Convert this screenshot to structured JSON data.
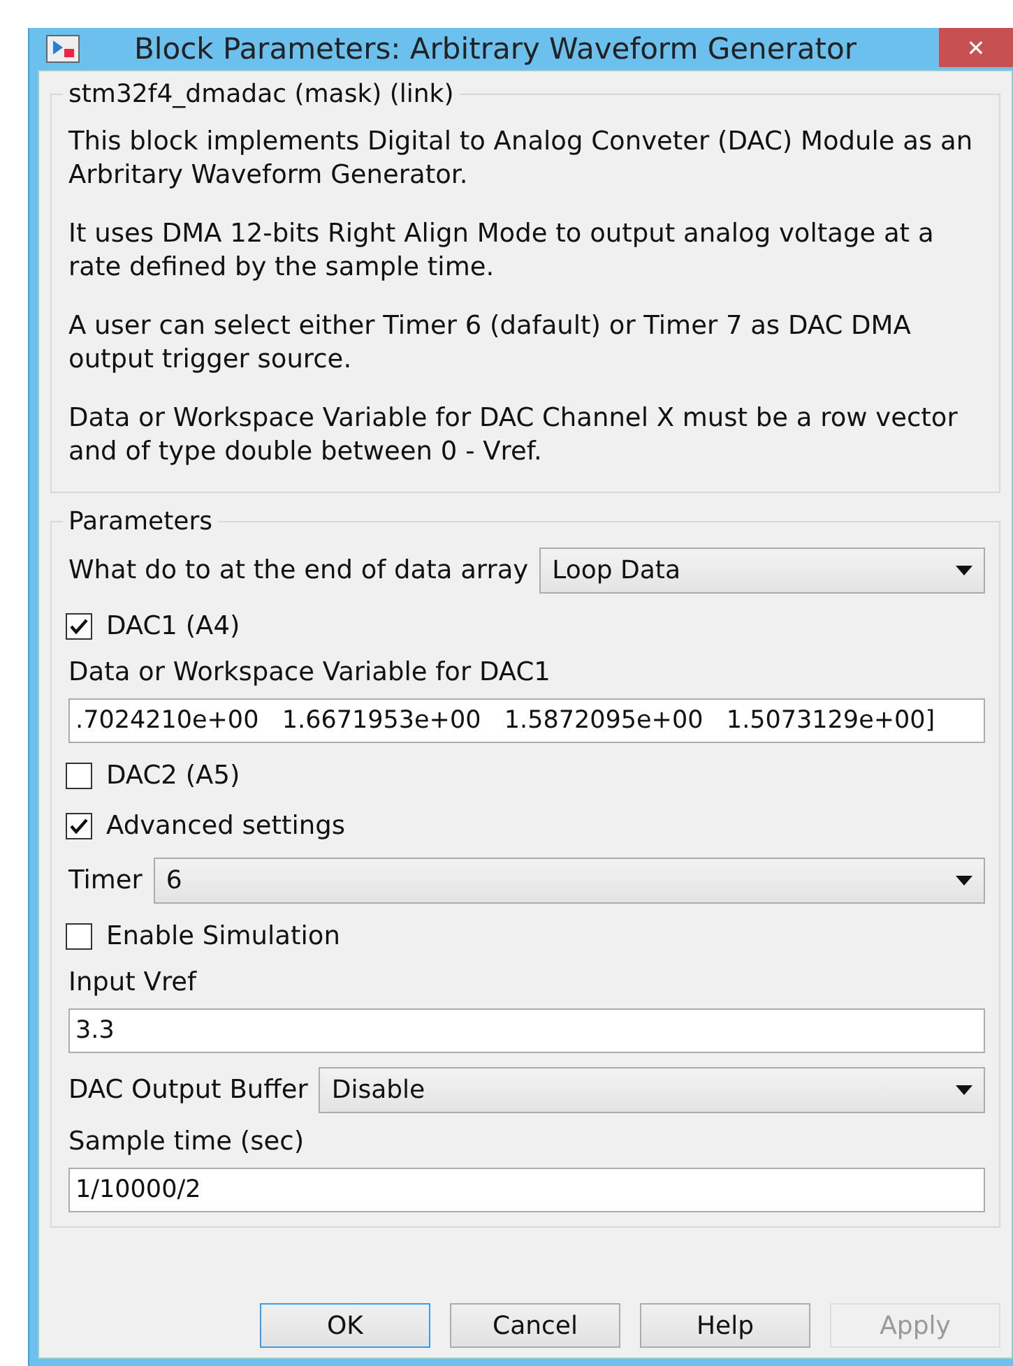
{
  "window": {
    "title": "Block Parameters: Arbitrary Waveform Generator",
    "close_glyph": "✕"
  },
  "description": {
    "title": "stm32f4_dmadac (mask) (link)",
    "paragraphs": [
      "This block implements Digital to Analog Conveter (DAC) Module as an Arbritary Waveform Generator.",
      "It uses DMA 12-bits Right Align Mode to output analog voltage at a rate defined by the sample time.",
      "A user can select either Timer 6 (dafault) or Timer 7 as DAC DMA output trigger source.",
      "Data or Workspace Variable for DAC Channel X must be a row vector and of type double between 0 - Vref."
    ]
  },
  "parameters": {
    "title": "Parameters",
    "items": [
      {
        "kind": "popup",
        "label": "What do to at the end of data array",
        "value": "Loop Data"
      },
      {
        "kind": "checkbox",
        "label": "DAC1 (A4)",
        "checked": true
      },
      {
        "kind": "edit",
        "label": "Data or Workspace Variable for DAC1",
        "value": ".7024210e+00   1.6671953e+00   1.5872095e+00   1.5073129e+00]"
      },
      {
        "kind": "checkbox",
        "label": "DAC2 (A5)",
        "checked": false
      },
      {
        "kind": "checkbox",
        "label": "Advanced settings",
        "checked": true
      },
      {
        "kind": "popup",
        "label": "Timer",
        "value": "6"
      },
      {
        "kind": "checkbox",
        "label": "Enable Simulation",
        "checked": false
      },
      {
        "kind": "edit",
        "label": "Input Vref",
        "value": "3.3"
      },
      {
        "kind": "popup",
        "label": "DAC Output Buffer",
        "value": "Disable"
      },
      {
        "kind": "edit",
        "label": "Sample time (sec)",
        "value": "1/10000/2"
      }
    ]
  },
  "buttons": [
    {
      "label": "OK",
      "default": true,
      "disabled": false
    },
    {
      "label": "Cancel",
      "default": false,
      "disabled": false
    },
    {
      "label": "Help",
      "default": false,
      "disabled": false
    },
    {
      "label": "Apply",
      "default": false,
      "disabled": true
    }
  ]
}
